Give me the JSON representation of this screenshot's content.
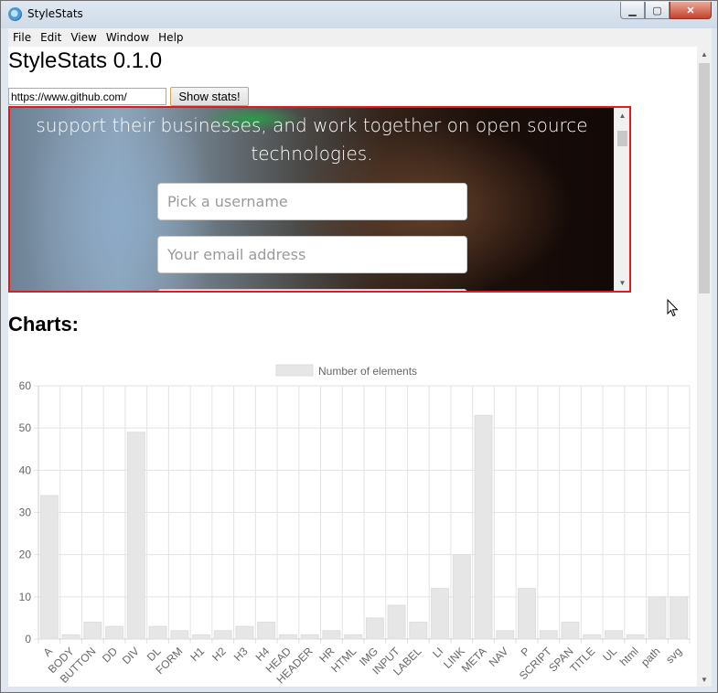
{
  "window": {
    "title": "StyleStats",
    "min_label": "▁",
    "max_label": "▢",
    "close_label": "✕"
  },
  "menu": [
    "File",
    "Edit",
    "View",
    "Window",
    "Help"
  ],
  "app": {
    "title": "StyleStats 0.1.0",
    "url_value": "https://www.github.com/",
    "show_button": "Show stats!"
  },
  "preview": {
    "headline_line1": "support their businesses, and work together on open source",
    "headline_line2": "technologies.",
    "username_placeholder": "Pick a username",
    "email_placeholder": "Your email address"
  },
  "charts_heading": "Charts:",
  "chart_data": {
    "type": "bar",
    "legend": "Number of elements",
    "legend_position": "top",
    "categories": [
      "A",
      "BODY",
      "BUTTON",
      "DD",
      "DIV",
      "DL",
      "FORM",
      "H1",
      "H2",
      "H3",
      "H4",
      "HEAD",
      "HEADER",
      "HR",
      "HTML",
      "IMG",
      "INPUT",
      "LABEL",
      "LI",
      "LINK",
      "META",
      "NAV",
      "P",
      "SCRIPT",
      "SPAN",
      "TITLE",
      "UL",
      "html",
      "path",
      "svg"
    ],
    "values": [
      34,
      1,
      4,
      3,
      49,
      3,
      2,
      1,
      2,
      3,
      4,
      1,
      1,
      2,
      1,
      5,
      8,
      4,
      12,
      20,
      53,
      2,
      12,
      2,
      4,
      1,
      2,
      1,
      10,
      10
    ],
    "yticks": [
      0,
      10,
      20,
      30,
      40,
      50,
      60
    ],
    "ylim": [
      0,
      60
    ],
    "grid": true,
    "bar_color": "#e6e6e6",
    "grid_color": "#e3e3e3"
  }
}
